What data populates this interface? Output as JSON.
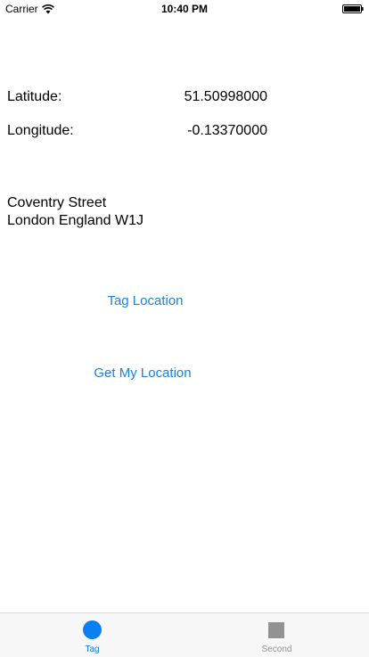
{
  "status_bar": {
    "carrier": "Carrier",
    "time": "10:40 PM",
    "wifi_icon": "wifi-icon",
    "battery_icon": "battery-full-icon"
  },
  "location": {
    "latitude_label": "Latitude:",
    "latitude_value": "51.50998000",
    "longitude_label": "Longitude:",
    "longitude_value": "-0.13370000"
  },
  "address": {
    "line1": "Coventry Street",
    "line2": "London England W1J"
  },
  "buttons": {
    "tag_location": "Tag Location",
    "get_my_location": "Get My Location"
  },
  "tab_bar": {
    "tabs": [
      {
        "label": "Tag",
        "icon": "circle-icon",
        "selected": true
      },
      {
        "label": "Second",
        "icon": "square-icon",
        "selected": false
      }
    ]
  },
  "colors": {
    "accent": "#0a7ff2",
    "link": "#1a82d8",
    "inactive": "#929292",
    "tab_bar_bg": "#f7f7f7"
  }
}
